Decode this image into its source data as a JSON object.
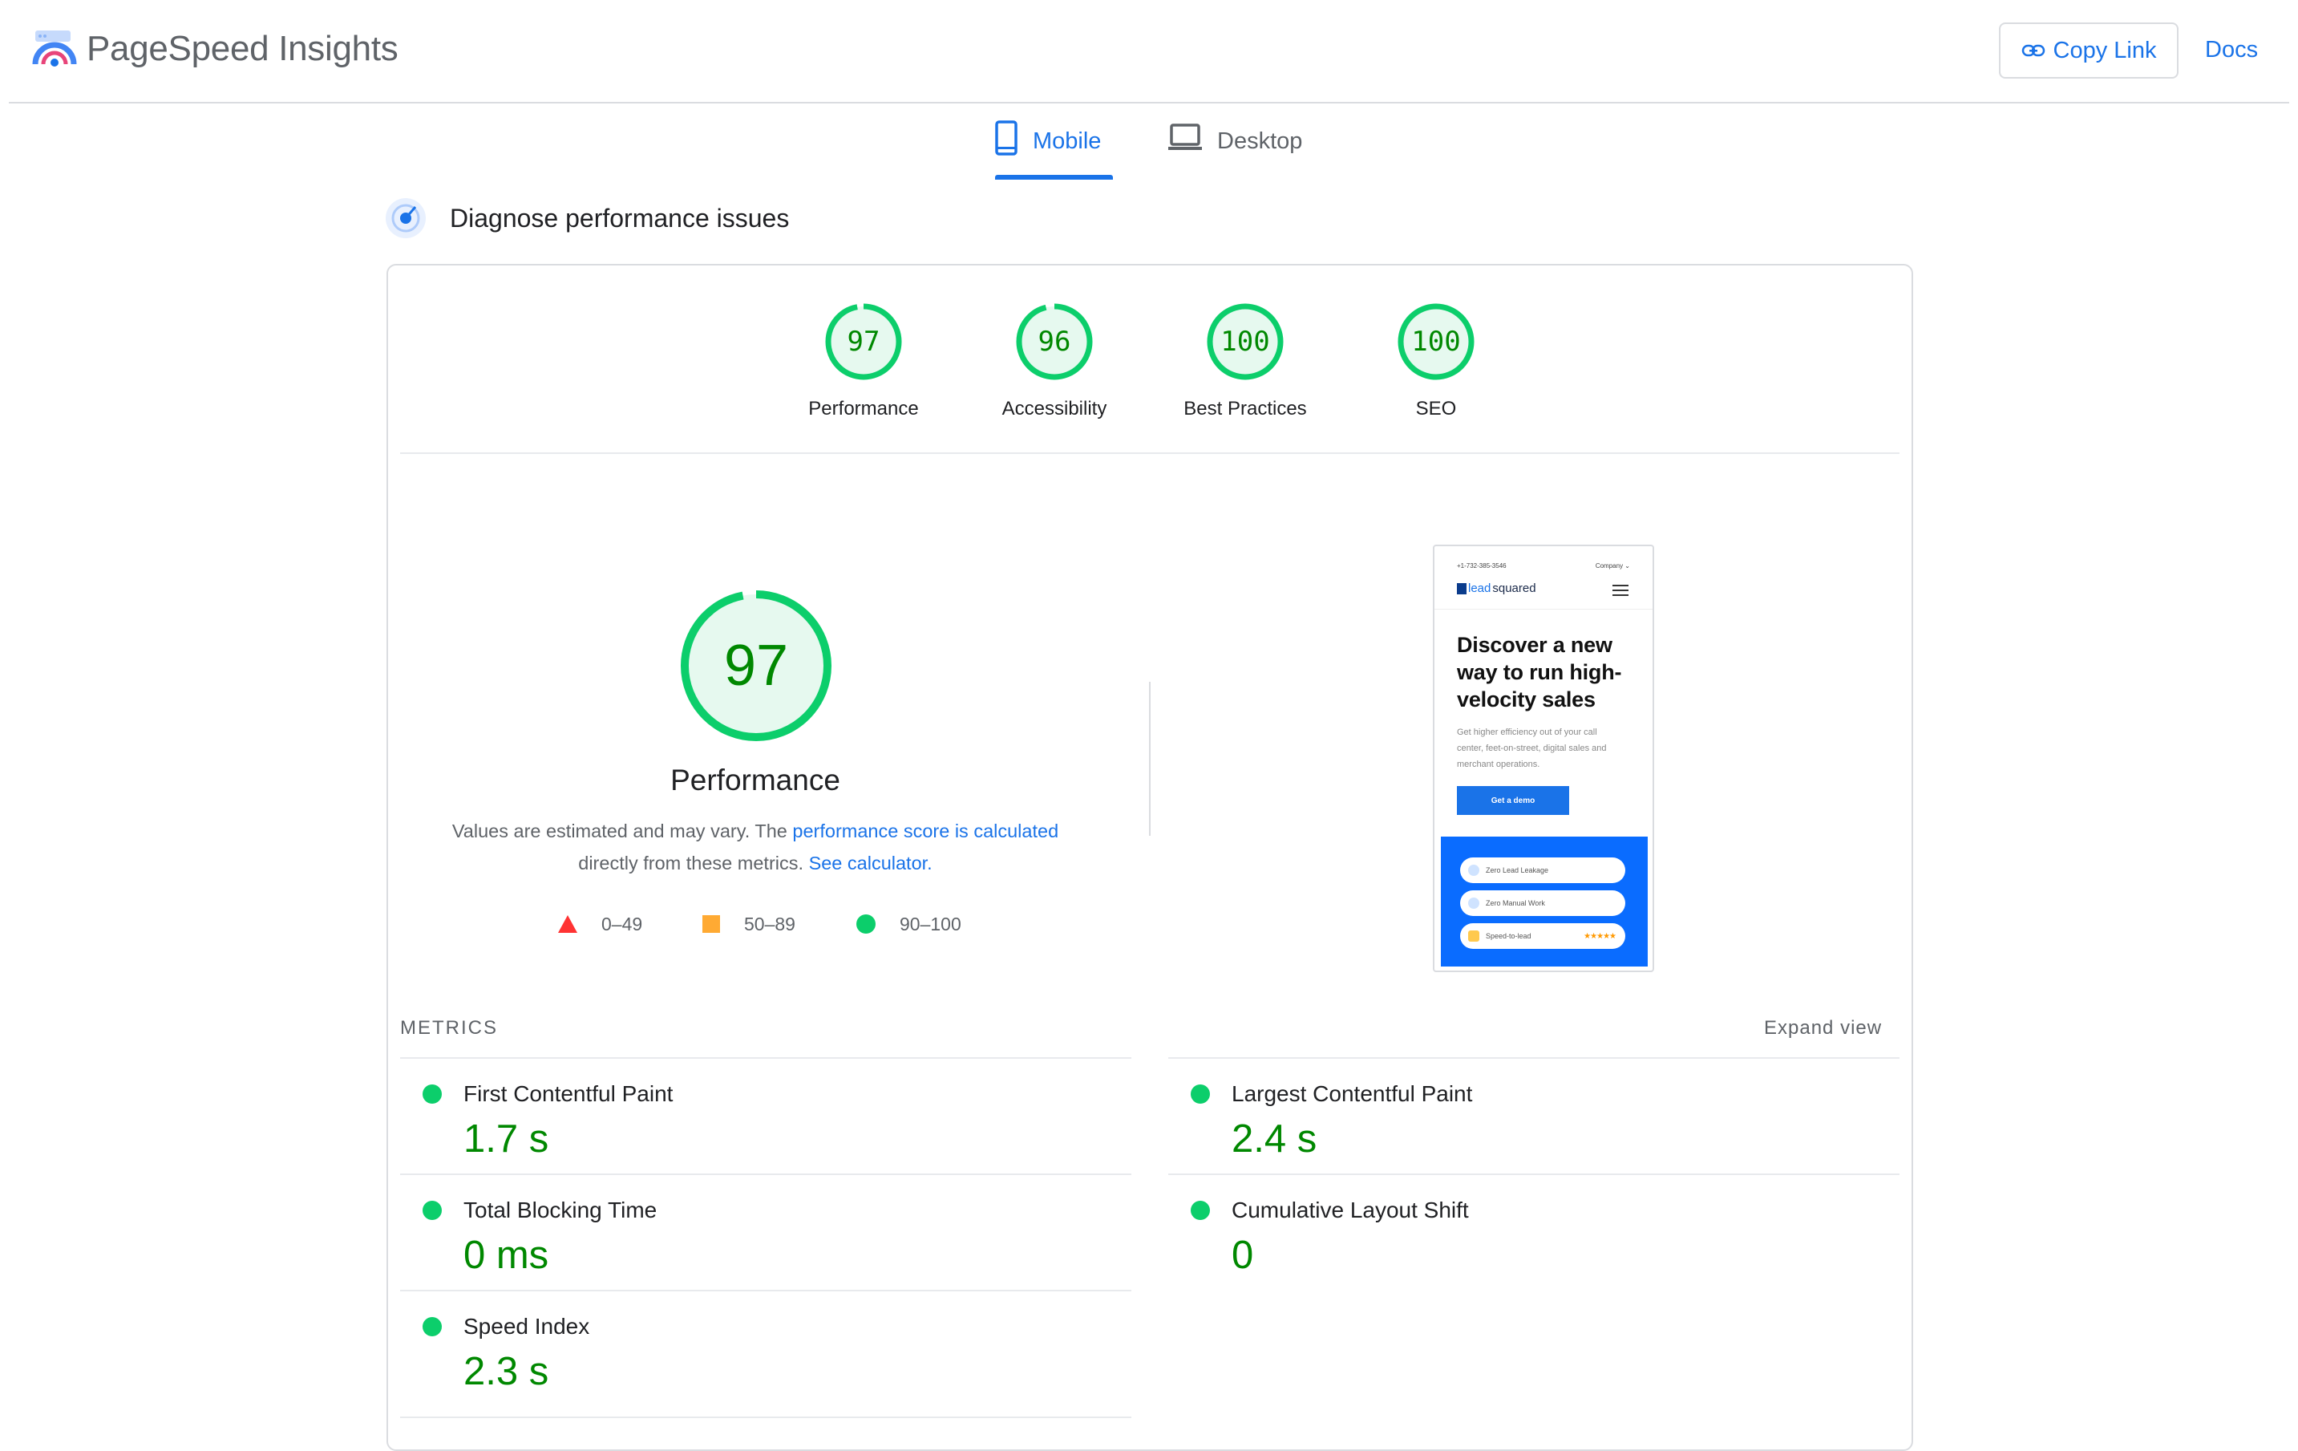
{
  "header": {
    "app_title": "PageSpeed Insights",
    "copy_link_label": "Copy Link",
    "docs_label": "Docs"
  },
  "tabs": [
    {
      "label": "Mobile",
      "selected": true
    },
    {
      "label": "Desktop",
      "selected": false
    }
  ],
  "section": {
    "title": "Diagnose performance issues"
  },
  "scores": [
    {
      "label": "Performance",
      "value": "97",
      "score": 97
    },
    {
      "label": "Accessibility",
      "value": "96",
      "score": 96
    },
    {
      "label": "Best Practices",
      "value": "100",
      "score": 100
    },
    {
      "label": "SEO",
      "value": "100",
      "score": 100
    }
  ],
  "performance": {
    "value": "97",
    "score": 97,
    "label": "Performance",
    "desc_prefix": "Values are estimated and may vary. The ",
    "desc_link": "performance score is calculated",
    "desc_middle": " directly from these metrics. ",
    "desc_calc_link": "See calculator."
  },
  "legend": [
    {
      "range": "0–49",
      "shape": "triangle",
      "color": "#ff3333"
    },
    {
      "range": "50–89",
      "shape": "square",
      "color": "#ffaa33"
    },
    {
      "range": "90–100",
      "shape": "circle",
      "color": "#0cce6b"
    }
  ],
  "screenshot": {
    "phone": "+1-732-385-3546",
    "company_menu": "Company ⌄",
    "brand_light": "lead",
    "brand_dark": "squared",
    "heading": "Discover a new way to run high-velocity sales",
    "subtext": "Get higher efficiency out of your call center, feet-on-street, digital sales and merchant operations.",
    "cta": "Get a demo",
    "pills": [
      "Zero Lead Leakage",
      "Zero Manual Work",
      "Speed-to-lead"
    ],
    "stars": "★★★★★"
  },
  "metrics": {
    "title": "METRICS",
    "expand_label": "Expand view",
    "items": [
      {
        "name": "First Contentful Paint",
        "value": "1.7 s"
      },
      {
        "name": "Largest Contentful Paint",
        "value": "2.4 s"
      },
      {
        "name": "Total Blocking Time",
        "value": "0 ms"
      },
      {
        "name": "Cumulative Layout Shift",
        "value": "0"
      },
      {
        "name": "Speed Index",
        "value": "2.3 s"
      }
    ]
  },
  "colors": {
    "accent": "#1a73e8",
    "pass": "#0cce6b",
    "pass_text": "#008800",
    "pass_fill": "#e6f9ef"
  }
}
